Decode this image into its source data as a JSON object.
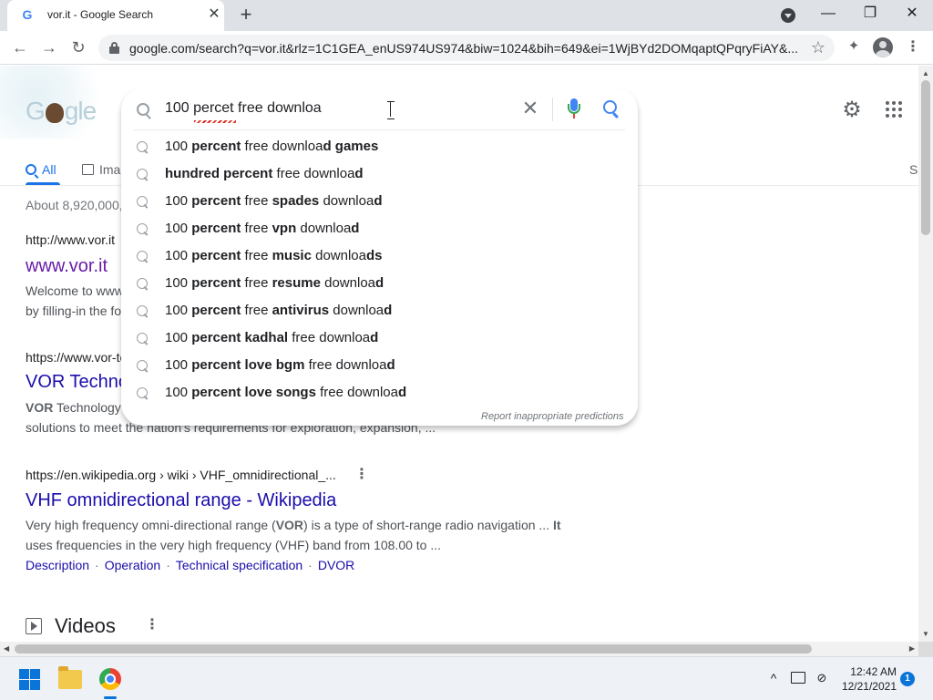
{
  "browser": {
    "tab_title": "vor.it - Google Search",
    "tab_favicon": "G",
    "tab_close": "✕",
    "new_tab": "+",
    "url": "google.com/search?q=vor.it&rlz=1C1GEA_enUS974US974&biw=1024&bih=649&ei=1WjBYd2DOMqaptQPqryFiAY&...",
    "window_controls": {
      "minimize": "—",
      "maximize": "❐",
      "close": "✕"
    },
    "nav": {
      "back": "←",
      "forward": "→",
      "reload": "↻"
    },
    "star": "☆",
    "extensions": "✦",
    "menu": "⋮"
  },
  "google": {
    "logo_left": "G",
    "logo_right": "gle",
    "settings_icon": "⚙",
    "tabs": [
      {
        "label": "All"
      },
      {
        "label": "Ima"
      }
    ],
    "right_tab": "S",
    "result_stats": "About 8,920,000,"
  },
  "searchbox": {
    "query": "100 percet free downloa",
    "clear": "✕",
    "suggestions": [
      {
        "parts": [
          "100 ",
          "percent",
          " free downloa",
          "d games"
        ],
        "bold": [
          false,
          true,
          false,
          true
        ]
      },
      {
        "parts": [
          "hundred percent",
          " free downloa",
          "d"
        ],
        "bold": [
          true,
          false,
          true
        ]
      },
      {
        "parts": [
          "100 ",
          "percent",
          " free ",
          "spades",
          " downloa",
          "d"
        ],
        "bold": [
          false,
          true,
          false,
          true,
          false,
          true
        ]
      },
      {
        "parts": [
          "100 ",
          "percent",
          " free ",
          "vpn",
          " downloa",
          "d"
        ],
        "bold": [
          false,
          true,
          false,
          true,
          false,
          true
        ]
      },
      {
        "parts": [
          "100 ",
          "percent",
          " free ",
          "music",
          " downloa",
          "ds"
        ],
        "bold": [
          false,
          true,
          false,
          true,
          false,
          true
        ]
      },
      {
        "parts": [
          "100 ",
          "percent",
          " free ",
          "resume",
          " downloa",
          "d"
        ],
        "bold": [
          false,
          true,
          false,
          true,
          false,
          true
        ]
      },
      {
        "parts": [
          "100 ",
          "percent",
          " free ",
          "antivirus",
          " downloa",
          "d"
        ],
        "bold": [
          false,
          true,
          false,
          true,
          false,
          true
        ]
      },
      {
        "parts": [
          "100 ",
          "percent kadhal",
          " free downloa",
          "d"
        ],
        "bold": [
          false,
          true,
          false,
          true
        ]
      },
      {
        "parts": [
          "100 ",
          "percent love bgm",
          " free downloa",
          "d"
        ],
        "bold": [
          false,
          true,
          false,
          true
        ]
      },
      {
        "parts": [
          "100 ",
          "percent love songs",
          " free downloa",
          "d"
        ],
        "bold": [
          false,
          true,
          false,
          true
        ]
      }
    ],
    "report": "Report inappropriate predictions"
  },
  "results": [
    {
      "url": "http://www.vor.it",
      "title": "www.vor.it",
      "snippet_1": "Welcome to www",
      "snippet_2": "by filling-in the fo"
    },
    {
      "url": "https://www.vor-te",
      "title": "VOR Techno",
      "snippet_1_bold": "VOR",
      "snippet_1": " Technology",
      "snippet_2": "solutions to meet the nation's requirements for exploration, expansion, ..."
    },
    {
      "url": "https://en.wikipedia.org › wiki › VHF_omnidirectional_...",
      "title": "VHF omnidirectional range - Wikipedia",
      "snippet_1_a": "Very high frequency omni-directional range (",
      "snippet_1_bold": "VOR",
      "snippet_1_b": ") is a type of short-range radio navigation ... ",
      "snippet_1_bold2": "It",
      "snippet_2": "uses frequencies in the very high frequency (VHF) band from 108.00 to ...",
      "links": [
        "Description",
        "Operation",
        "Technical specification",
        "DVOR"
      ],
      "link_sep": "·"
    }
  ],
  "videos": {
    "title": "Videos"
  },
  "kebab": "⋮",
  "taskbar": {
    "time": "12:42 AM",
    "date": "12/21/2021",
    "notifications": "1",
    "tray_chevron": "^"
  },
  "colors": {
    "link": "#1a0dab",
    "visited": "#681da8",
    "accent": "#1a73e8",
    "taskbar": "#eef1f6"
  }
}
